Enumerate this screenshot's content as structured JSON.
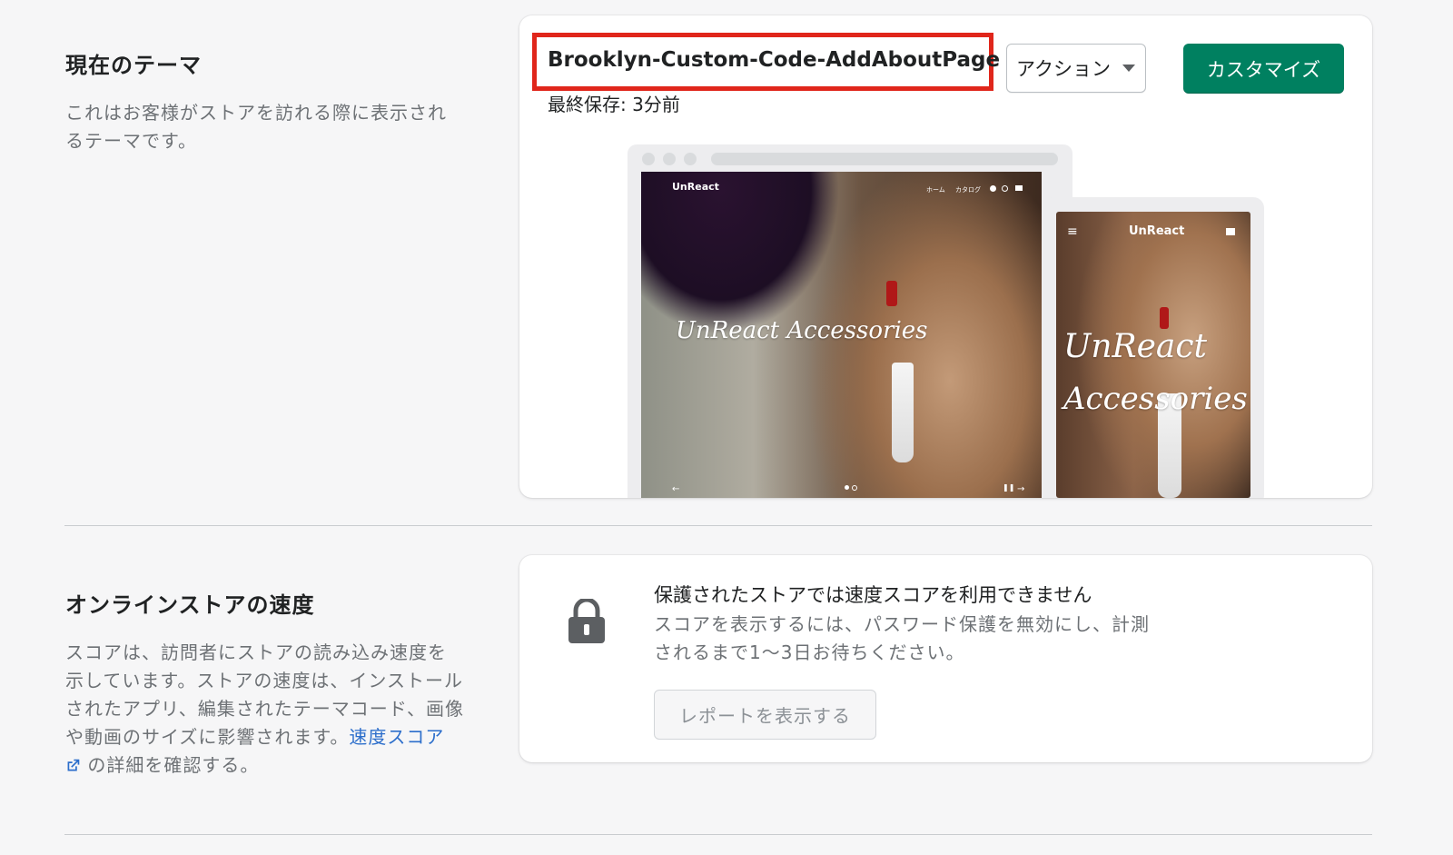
{
  "current_theme": {
    "section_title": "現在のテーマ",
    "section_desc": "これはお客様がストアを訪れる際に表示されるテーマです。",
    "theme_name": "Brooklyn-Custom-Code-AddAboutPage",
    "last_saved": "最終保存: 3分前",
    "actions_label": "アクション",
    "customize_label": "カスタマイズ",
    "preview": {
      "logo": "UnReact",
      "hero_text": "UnReact Accessories",
      "mobile_hero_line1": "UnReact",
      "mobile_hero_line2": "Accessories",
      "nav_home": "ホーム",
      "nav_catalog": "カタログ"
    }
  },
  "speed": {
    "section_title": "オンラインストアの速度",
    "desc_before_link": "スコアは、訪問者にストアの読み込み速度を示しています。ストアの速度は、インストールされたアプリ、編集されたテーマコード、画像や動画のサイズに影響されます。",
    "link_text": "速度スコア",
    "desc_after_link": "の詳細を確認する。",
    "card_title": "保護されたストアでは速度スコアを利用できません",
    "card_desc": "スコアを表示するには、パスワード保護を無効にし、計測されるまで1〜3日お待ちください。",
    "report_button": "レポートを表示する"
  },
  "icons": {
    "lock": "lock-icon",
    "caret": "caret-down-icon",
    "external": "external-link-icon"
  }
}
